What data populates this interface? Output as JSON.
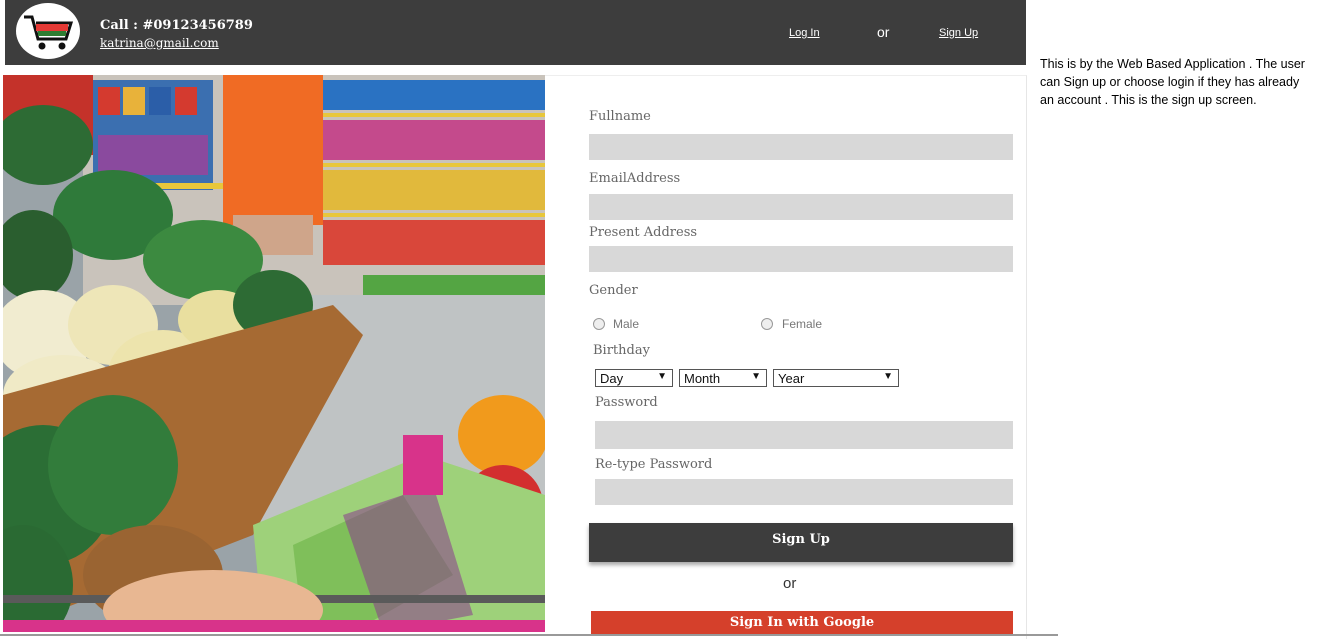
{
  "header": {
    "call": "Call : #09123456789",
    "email": "katrina@gmail.com",
    "login": "Log In",
    "or": "or",
    "signup": "Sign Up"
  },
  "form": {
    "fullname_label": "Fullname",
    "email_label": "EmailAddress",
    "address_label": "Present Address",
    "gender_label": "Gender",
    "male_label": "Male",
    "female_label": "Female",
    "birthday_label": "Birthday",
    "day": "Day",
    "month": "Month",
    "year": "Year",
    "password_label": "Password",
    "retype_label": "Re-type Password",
    "signup_button": "Sign Up",
    "or": "or",
    "google_button": "Sign In with Google"
  },
  "note": "This is by the Web Based Application . The user can Sign up or choose login if they has already an account . This is the sign up screen.",
  "colors": {
    "header_bg": "#3d3d3d",
    "field_bg": "#d8d8d8",
    "google_red": "#d5402b"
  }
}
